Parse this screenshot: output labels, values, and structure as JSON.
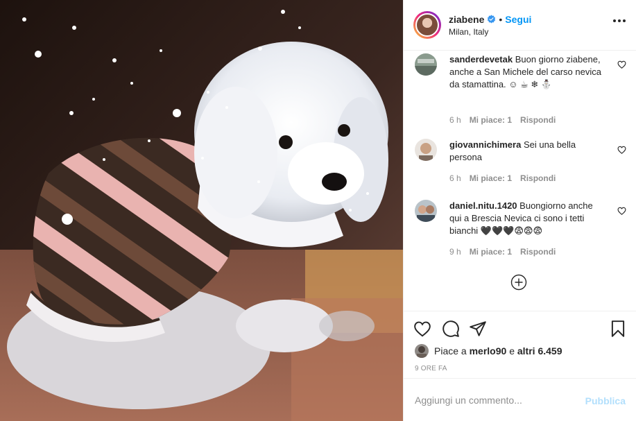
{
  "header": {
    "username": "ziabene",
    "separator": "•",
    "follow_label": "Segui",
    "location": "Milan, Italy"
  },
  "comments": [
    {
      "user": "sanderdevetak",
      "text": "Buon giorno ziabene, anche a San Michele del carso nevica da stamattina. ☺ ☕ ❄ ⛄",
      "time": "6 h",
      "likes": "Mi piace: 1",
      "reply": "Rispondi"
    },
    {
      "user": "giovannichimera",
      "text": "Sei una bella persona",
      "time": "6 h",
      "likes": "Mi piace: 1",
      "reply": "Rispondi"
    },
    {
      "user": "daniel.nitu.1420",
      "text": "Buongiorno anche qui a Brescia Nevica ci sono i tetti bianchi 🖤🖤🖤😨😨😨",
      "time": "9 h",
      "likes": "Mi piace: 1",
      "reply": "Rispondi"
    }
  ],
  "likes": {
    "prefix": "Piace a",
    "user": "merlo90",
    "conj": "e",
    "others": "altri 6.459"
  },
  "timestamp": "9 ORE FA",
  "composer": {
    "placeholder": "Aggiungi un commento...",
    "publish_label": "Pubblica"
  },
  "colors": {
    "accent": "#0095f6",
    "publish_disabled": "#b2dffc",
    "muted": "#8e8e8e"
  },
  "icons": {
    "more": "more-options-icon",
    "verified": "verified-badge-icon",
    "like": "heart-icon",
    "comment": "comment-icon",
    "share": "paper-plane-icon",
    "save": "bookmark-icon",
    "load_more": "plus-circle-icon"
  }
}
